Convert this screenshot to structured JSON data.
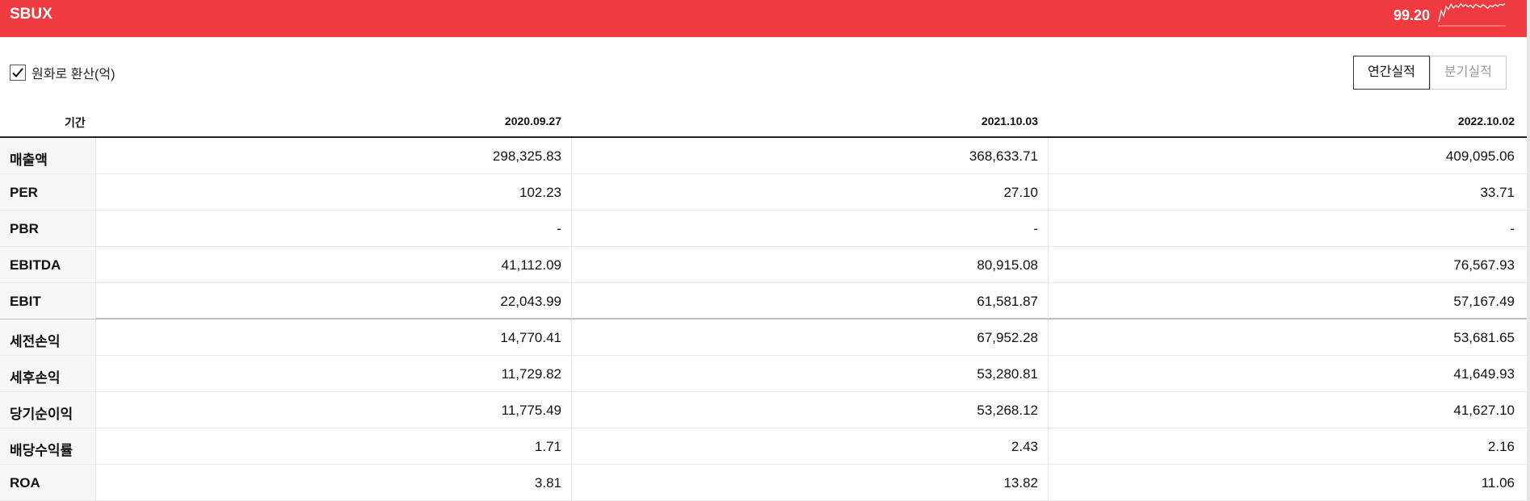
{
  "header": {
    "ticker": "SBUX",
    "price": "99.20",
    "sparkline": [
      78,
      35,
      55,
      20,
      30,
      10,
      25,
      15,
      22,
      8,
      18,
      12,
      20,
      14,
      24,
      10,
      16,
      22,
      12,
      18,
      26,
      15,
      20,
      12,
      18,
      10,
      14,
      8
    ]
  },
  "controls": {
    "convert_label": "원화로 환산(억)",
    "convert_checked": true,
    "annual_label": "연간실적",
    "quarter_label": "분기실적"
  },
  "table": {
    "period_header": "기간",
    "columns": [
      "2020.09.27",
      "2021.10.03",
      "2022.10.02"
    ],
    "rows": [
      {
        "label": "매출액",
        "values": [
          "298,325.83",
          "368,633.71",
          "409,095.06"
        ]
      },
      {
        "label": "PER",
        "values": [
          "102.23",
          "27.10",
          "33.71"
        ]
      },
      {
        "label": "PBR",
        "values": [
          "-",
          "-",
          "-"
        ]
      },
      {
        "label": "EBITDA",
        "values": [
          "41,112.09",
          "80,915.08",
          "76,567.93"
        ]
      },
      {
        "label": "EBIT",
        "values": [
          "22,043.99",
          "61,581.87",
          "57,167.49"
        ]
      },
      {
        "label": "세전손익",
        "values": [
          "14,770.41",
          "67,952.28",
          "53,681.65"
        ]
      },
      {
        "label": "세후손익",
        "values": [
          "11,729.82",
          "53,280.81",
          "41,649.93"
        ]
      },
      {
        "label": "당기순이익",
        "values": [
          "11,775.49",
          "53,268.12",
          "41,627.10"
        ]
      },
      {
        "label": "배당수익률",
        "values": [
          "1.71",
          "2.43",
          "2.16"
        ]
      },
      {
        "label": "ROA",
        "values": [
          "3.81",
          "13.82",
          "11.06"
        ]
      }
    ]
  },
  "colors": {
    "header_bg": "#ef3b3f",
    "header_text": "#ffffff"
  }
}
